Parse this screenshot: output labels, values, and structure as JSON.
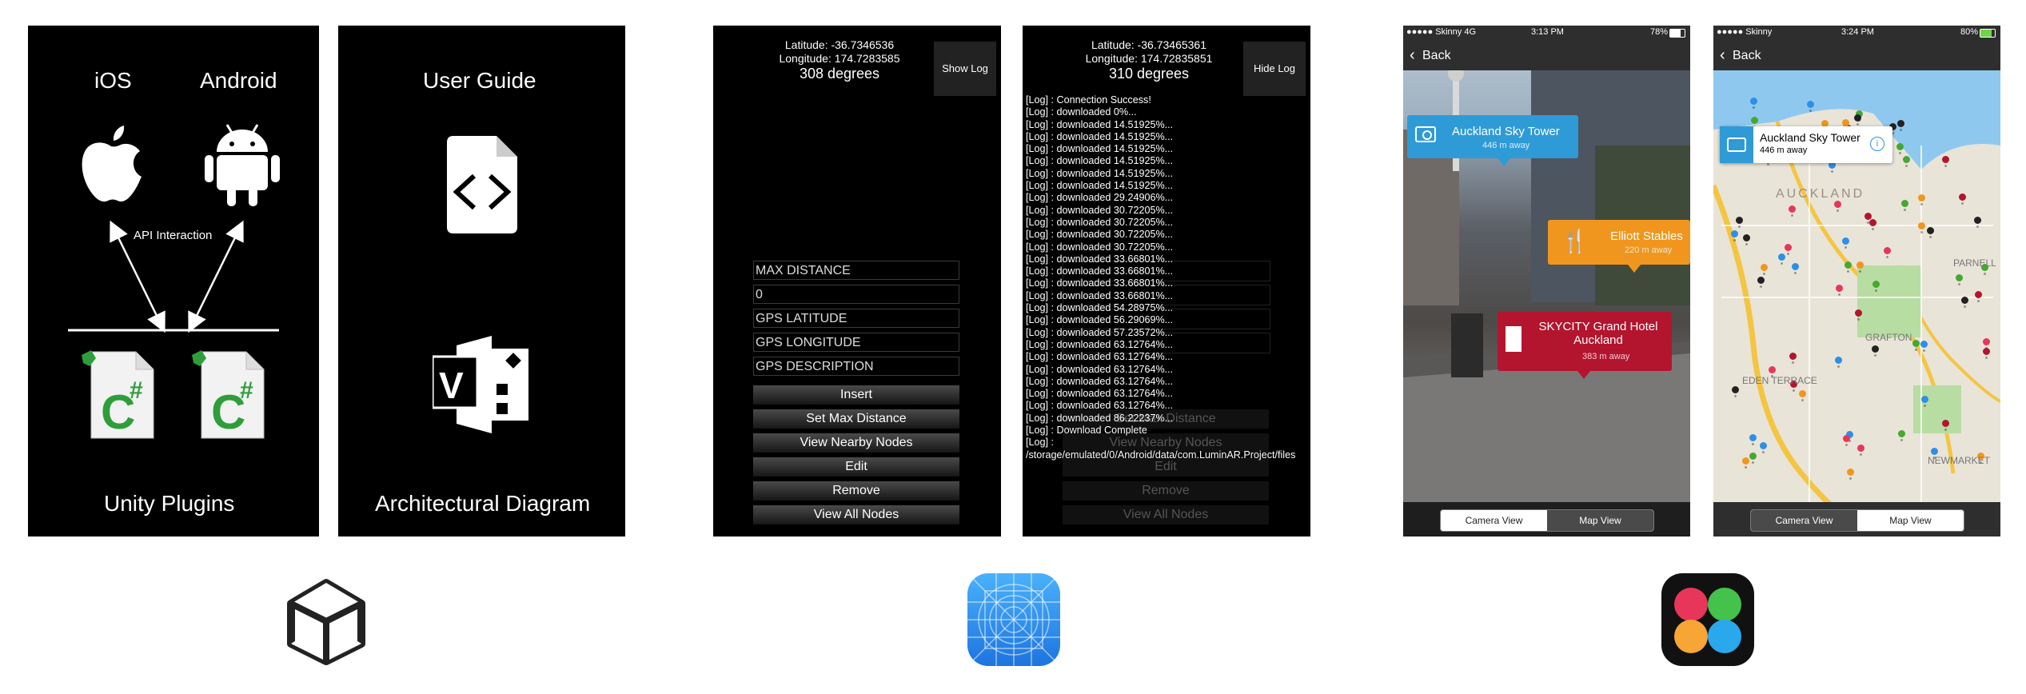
{
  "panel_unity_plugins": {
    "ios_label": "iOS",
    "android_label": "Android",
    "api_label": "API Interaction",
    "footer_label": "Unity Plugins"
  },
  "panel_docs": {
    "user_guide_label": "User Guide",
    "diagram_label": "Architectural Diagram"
  },
  "android_main": {
    "latitude": "Latitude: -36.7346536",
    "longitude": "Longitude: 174.7283585",
    "heading": "308 degrees",
    "log_button": "Show Log",
    "fields": [
      "MAX DISTANCE",
      "0",
      "GPS LATITUDE",
      "GPS LONGITUDE",
      "GPS DESCRIPTION"
    ],
    "buttons": [
      "Insert",
      "Set Max Distance",
      "View Nearby Nodes",
      "Edit",
      "Remove",
      "View All Nodes"
    ]
  },
  "android_log": {
    "latitude": "Latitude: -36.73465361",
    "longitude": "Longitude: 174.72835851",
    "heading": "310 degrees",
    "log_button": "Hide Log",
    "log_lines": [
      "[Log] : Connection Success!",
      "[Log] : downloaded 0%...",
      "[Log] : downloaded 14.51925%...",
      "[Log] : downloaded 14.51925%...",
      "[Log] : downloaded 14.51925%...",
      "[Log] : downloaded 14.51925%...",
      "[Log] : downloaded 14.51925%...",
      "[Log] : downloaded 14.51925%...",
      "[Log] : downloaded 29.24906%...",
      "[Log] : downloaded 30.72205%...",
      "[Log] : downloaded 30.72205%...",
      "[Log] : downloaded 30.72205%...",
      "[Log] : downloaded 30.72205%...",
      "[Log] : downloaded 33.66801%...",
      "[Log] : downloaded 33.66801%...",
      "[Log] : downloaded 33.66801%...",
      "[Log] : downloaded 33.66801%...",
      "[Log] : downloaded 54.28975%...",
      "[Log] : downloaded 56.29069%...",
      "[Log] : downloaded 57.23572%...",
      "[Log] : downloaded 63.12764%...",
      "[Log] : downloaded 63.12764%...",
      "[Log] : downloaded 63.12764%...",
      "[Log] : downloaded 63.12764%...",
      "[Log] : downloaded 63.12764%...",
      "[Log] : downloaded 63.12764%...",
      "[Log] : downloaded 86.22237%...",
      "[Log] : Download Complete",
      "[Log] :",
      "/storage/emulated/0/Android/data/com.LuminAR.Project/files"
    ],
    "faded_buttons": [
      "Set Max Distance",
      "View Nearby Nodes",
      "Edit",
      "Remove",
      "View All Nodes"
    ]
  },
  "ios_camera": {
    "carrier": "●●●●● Skinny  4G",
    "time": "3:13 PM",
    "battery": "78%",
    "back_label": "Back",
    "callouts": [
      {
        "title": "Auckland Sky Tower",
        "distance": "446 m away",
        "color": "#2f9bd6"
      },
      {
        "title": "Elliott Stables",
        "distance": "220 m away",
        "color": "#f0961e"
      },
      {
        "title": "SKYCITY Grand Hotel Auckland",
        "distance": "383 m away",
        "color": "#b3152e"
      }
    ],
    "tabs": [
      "Camera View",
      "Map View"
    ],
    "selected_tab": "Camera View"
  },
  "ios_map": {
    "carrier": "●●●●● Skinny",
    "time": "3:24 PM",
    "battery": "80%",
    "back_label": "Back",
    "callout_title": "Auckland Sky Tower",
    "callout_distance": "446 m away",
    "map_labels": [
      "AUCKLAND",
      "GRAFTON",
      "EDEN TERRACE",
      "NEWMARKET",
      "PARNELL"
    ],
    "tabs": [
      "Camera View",
      "Map View"
    ],
    "selected_tab": "Camera View"
  },
  "app_icons": [
    "unity-logo-icon",
    "ios-app-blueprint-icon",
    "game-center-icon"
  ],
  "colors": {
    "csharp_green": "#2e9e3a",
    "ios_blue": "#2e8fe6",
    "callout_blue": "#2f9bd6",
    "callout_orange": "#f0961e",
    "callout_red": "#b3152e",
    "map_road": "#f4c542"
  }
}
